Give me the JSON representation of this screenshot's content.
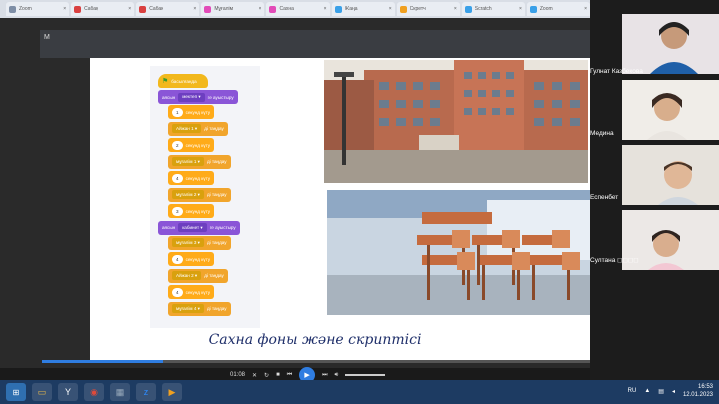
{
  "browser": {
    "tabs": [
      {
        "label": "Zoom",
        "color": "#7e8ea6"
      },
      {
        "label": "Сабақ",
        "color": "#d94040"
      },
      {
        "label": "Сабақ",
        "color": "#d94040"
      },
      {
        "label": "Мұғалім",
        "color": "#e24bb8"
      },
      {
        "label": "Сахна",
        "color": "#e24bb8"
      },
      {
        "label": "Жаңа",
        "color": "#3aa0e8"
      },
      {
        "label": "Скретч",
        "color": "#f0a020"
      },
      {
        "label": "Scratch",
        "color": "#3aa0e8"
      },
      {
        "label": "Zoom",
        "color": "#3aa0e8"
      }
    ]
  },
  "stage": {
    "corner_letter": "M"
  },
  "script": {
    "event_label": "басылғанда",
    "blocks": [
      {
        "type": "look",
        "prefix": "аясын",
        "value": "мектеп",
        "suffix": "ге ауыстыру"
      },
      {
        "type": "wait",
        "num": "1",
        "suffix": "секунд күту"
      },
      {
        "type": "ctrl",
        "value": "Айжан 1",
        "suffix": "ді таңдау"
      },
      {
        "type": "wait",
        "num": "2",
        "suffix": "секунд күту"
      },
      {
        "type": "ctrl",
        "value": "мұғалім 1",
        "suffix": "ді таңдау"
      },
      {
        "type": "wait",
        "num": "4",
        "suffix": "секунд күту"
      },
      {
        "type": "ctrl",
        "value": "мұғалім 2",
        "suffix": "ді таңдау"
      },
      {
        "type": "wait",
        "num": "3",
        "suffix": "секунд күту"
      },
      {
        "type": "look",
        "prefix": "аясын",
        "value": "кабинет",
        "suffix": "ге ауыстыру"
      },
      {
        "type": "ctrl",
        "value": "мұғалім 3",
        "suffix": "ді таңдау"
      },
      {
        "type": "wait",
        "num": "4",
        "suffix": "секунд күту"
      },
      {
        "type": "ctrl",
        "value": "Айжан 2",
        "suffix": "ді таңдау"
      },
      {
        "type": "wait",
        "num": "4",
        "suffix": "секунд күту"
      },
      {
        "type": "ctrl",
        "value": "мұғалім 4",
        "suffix": "ді таңдау"
      }
    ]
  },
  "slide": {
    "caption": "Сахна фоны және скриптісі"
  },
  "media": {
    "time": "01:08",
    "progress": 0.22
  },
  "participants": [
    {
      "name": "Гулнат Казбекова"
    },
    {
      "name": "Медина"
    },
    {
      "name": "Еспенбет"
    },
    {
      "name": "Султана ◻◻◻◻"
    }
  ],
  "taskbar": {
    "lang": "RU",
    "time": "16:53",
    "date": "12.01.2023",
    "icons": [
      {
        "name": "file-explorer-icon",
        "glyph": "▭",
        "color": "#e8b84a"
      },
      {
        "name": "yandex-icon",
        "glyph": "Y",
        "color": "#ffffff"
      },
      {
        "name": "chrome-icon",
        "glyph": "◉",
        "color": "#e04a3a"
      },
      {
        "name": "calculator-icon",
        "glyph": "▦",
        "color": "#9ab"
      },
      {
        "name": "zoom-icon",
        "glyph": "z",
        "color": "#2d8cff"
      },
      {
        "name": "media-player-icon",
        "glyph": "▶",
        "color": "#f0a020"
      }
    ]
  }
}
